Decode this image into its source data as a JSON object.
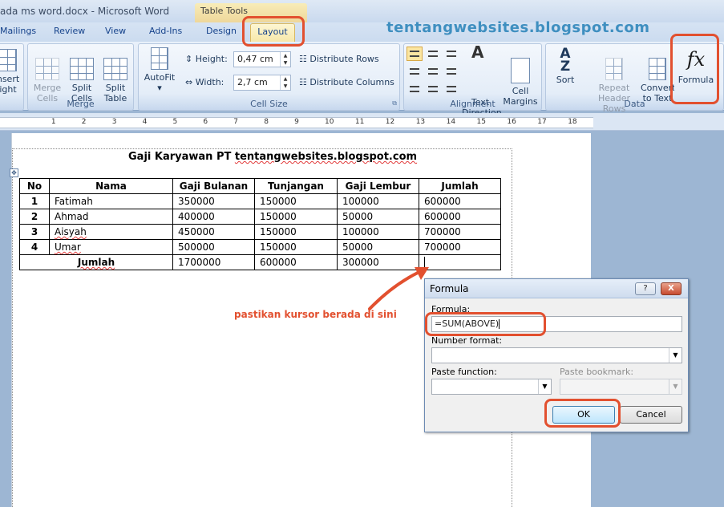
{
  "window": {
    "title": "ada ms word.docx - Microsoft Word",
    "context_tab_group": "Table Tools"
  },
  "tabs": [
    {
      "label": "Mailings"
    },
    {
      "label": "Review"
    },
    {
      "label": "View"
    },
    {
      "label": "Add-Ins"
    },
    {
      "label": "Design"
    },
    {
      "label": "Layout",
      "active": true
    }
  ],
  "watermark": "tentangwebsites.blogspot.com",
  "ribbon": {
    "rows_columns": {
      "insert_label_1": "nsert",
      "insert_label_2": "ight"
    },
    "merge": {
      "label": "Merge",
      "merge_cells": "Merge\nCells",
      "split_cells": "Split\nCells",
      "split_table": "Split\nTable"
    },
    "cell_size": {
      "label": "Cell Size",
      "autofit": "AutoFit",
      "height_label": "Height:",
      "height_value": "0,47 cm",
      "width_label": "Width:",
      "width_value": "2,7 cm",
      "distribute_rows": "Distribute Rows",
      "distribute_columns": "Distribute Columns"
    },
    "alignment": {
      "label": "Alignment",
      "text_direction": "Text\nDirection",
      "cell_margins": "Cell\nMargins"
    },
    "data": {
      "label": "Data",
      "sort": "Sort",
      "repeat_header_rows": "Repeat\nHeader Rows",
      "convert_to_text": "Convert\nto Text",
      "formula": "Formula"
    }
  },
  "ruler_numbers": [
    "1",
    "2",
    "3",
    "4",
    "5",
    "6",
    "7",
    "8",
    "9",
    "10",
    "11",
    "12",
    "13",
    "14",
    "15",
    "16",
    "17",
    "18"
  ],
  "document": {
    "title_prefix": "Gaji Karyawan PT ",
    "title_site": "tentangwebsites.blogspot.com",
    "table": {
      "headers": [
        "No",
        "Nama",
        "Gaji Bulanan",
        "Tunjangan",
        "Gaji Lembur",
        "Jumlah"
      ],
      "rows": [
        [
          "1",
          "Fatimah",
          "350000",
          "150000",
          "100000",
          "600000"
        ],
        [
          "2",
          "Ahmad",
          "400000",
          "150000",
          "50000",
          "600000"
        ],
        [
          "3",
          "Aisyah",
          "450000",
          "150000",
          "100000",
          "700000"
        ],
        [
          "4",
          "Umar",
          "500000",
          "150000",
          "50000",
          "700000"
        ]
      ],
      "total_row": [
        "Jumlah",
        "1700000",
        "600000",
        "300000",
        ""
      ]
    }
  },
  "annotation": "pastikan kursor berada di sini",
  "dialog": {
    "title": "Formula",
    "help": "?",
    "close": "X",
    "formula_label": "Formula:",
    "formula_value": "=SUM(ABOVE)",
    "number_format_label": "Number format:",
    "number_format_value": "",
    "paste_function_label": "Paste function:",
    "paste_bookmark_label": "Paste bookmark:",
    "ok": "OK",
    "cancel": "Cancel"
  },
  "colors": {
    "highlight": "#e2502f",
    "watermark": "#3f8fc0",
    "ribbon_bg": "#d6e3f3"
  }
}
